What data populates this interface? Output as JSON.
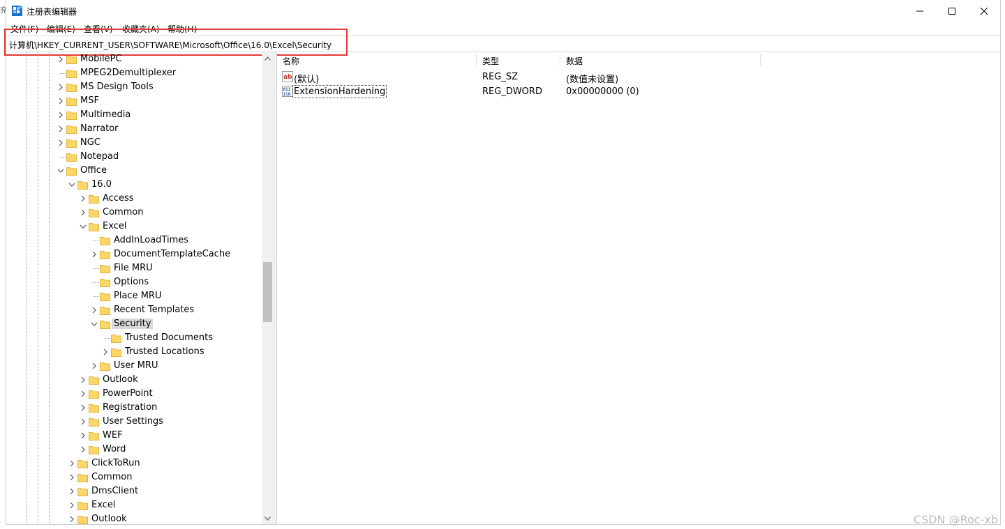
{
  "window": {
    "title": "注册表编辑器"
  },
  "menu": [
    {
      "label": "文件(F)"
    },
    {
      "label": "编辑(E)"
    },
    {
      "label": "查看(V)"
    },
    {
      "label": "收藏夹(A)"
    },
    {
      "label": "帮助(H)"
    }
  ],
  "address": {
    "path": "计算机\\HKEY_CURRENT_USER\\SOFTWARE\\Microsoft\\Office\\16.0\\Excel\\Security"
  },
  "tree": [
    {
      "label": "MobilePC",
      "level": 0,
      "expander": "collapsed"
    },
    {
      "label": "MPEG2Demultiplexer",
      "level": 0,
      "expander": "none"
    },
    {
      "label": "MS Design Tools",
      "level": 0,
      "expander": "collapsed"
    },
    {
      "label": "MSF",
      "level": 0,
      "expander": "collapsed"
    },
    {
      "label": "Multimedia",
      "level": 0,
      "expander": "collapsed"
    },
    {
      "label": "Narrator",
      "level": 0,
      "expander": "collapsed"
    },
    {
      "label": "NGC",
      "level": 0,
      "expander": "collapsed"
    },
    {
      "label": "Notepad",
      "level": 0,
      "expander": "none"
    },
    {
      "label": "Office",
      "level": 0,
      "expander": "expanded"
    },
    {
      "label": "16.0",
      "level": 1,
      "expander": "expanded"
    },
    {
      "label": "Access",
      "level": 2,
      "expander": "collapsed"
    },
    {
      "label": "Common",
      "level": 2,
      "expander": "collapsed"
    },
    {
      "label": "Excel",
      "level": 2,
      "expander": "expanded"
    },
    {
      "label": "AddInLoadTimes",
      "level": 3,
      "expander": "none"
    },
    {
      "label": "DocumentTemplateCache",
      "level": 3,
      "expander": "collapsed"
    },
    {
      "label": "File MRU",
      "level": 3,
      "expander": "none"
    },
    {
      "label": "Options",
      "level": 3,
      "expander": "none"
    },
    {
      "label": "Place MRU",
      "level": 3,
      "expander": "none"
    },
    {
      "label": "Recent Templates",
      "level": 3,
      "expander": "collapsed"
    },
    {
      "label": "Security",
      "level": 3,
      "expander": "expanded",
      "selected": true
    },
    {
      "label": "Trusted Documents",
      "level": 4,
      "expander": "none"
    },
    {
      "label": "Trusted Locations",
      "level": 4,
      "expander": "collapsed"
    },
    {
      "label": "User MRU",
      "level": 3,
      "expander": "collapsed"
    },
    {
      "label": "Outlook",
      "level": 2,
      "expander": "collapsed"
    },
    {
      "label": "PowerPoint",
      "level": 2,
      "expander": "collapsed"
    },
    {
      "label": "Registration",
      "level": 2,
      "expander": "collapsed"
    },
    {
      "label": "User Settings",
      "level": 2,
      "expander": "collapsed"
    },
    {
      "label": "WEF",
      "level": 2,
      "expander": "collapsed"
    },
    {
      "label": "Word",
      "level": 2,
      "expander": "collapsed"
    },
    {
      "label": "ClickToRun",
      "level": 1,
      "expander": "collapsed"
    },
    {
      "label": "Common",
      "level": 1,
      "expander": "collapsed"
    },
    {
      "label": "DmsClient",
      "level": 1,
      "expander": "collapsed"
    },
    {
      "label": "Excel",
      "level": 1,
      "expander": "collapsed"
    },
    {
      "label": "Outlook",
      "level": 1,
      "expander": "collapsed"
    }
  ],
  "list": {
    "columns": [
      {
        "label": "名称"
      },
      {
        "label": "类型"
      },
      {
        "label": "数据"
      }
    ],
    "rows": [
      {
        "icon": "string-value-icon",
        "name": "(默认)",
        "type": "REG_SZ",
        "data": "(数值未设置)"
      },
      {
        "icon": "dword-value-icon",
        "name": "ExtensionHardening",
        "type": "REG_DWORD",
        "data": "0x00000000 (0)",
        "focused": true
      }
    ]
  },
  "watermark": "CSDN @Roc-xb",
  "colors": {
    "folder": "#fcd667",
    "folder_edge": "#e0b440",
    "highlight_box": "#e53935",
    "selection": "#d9d9d9"
  }
}
